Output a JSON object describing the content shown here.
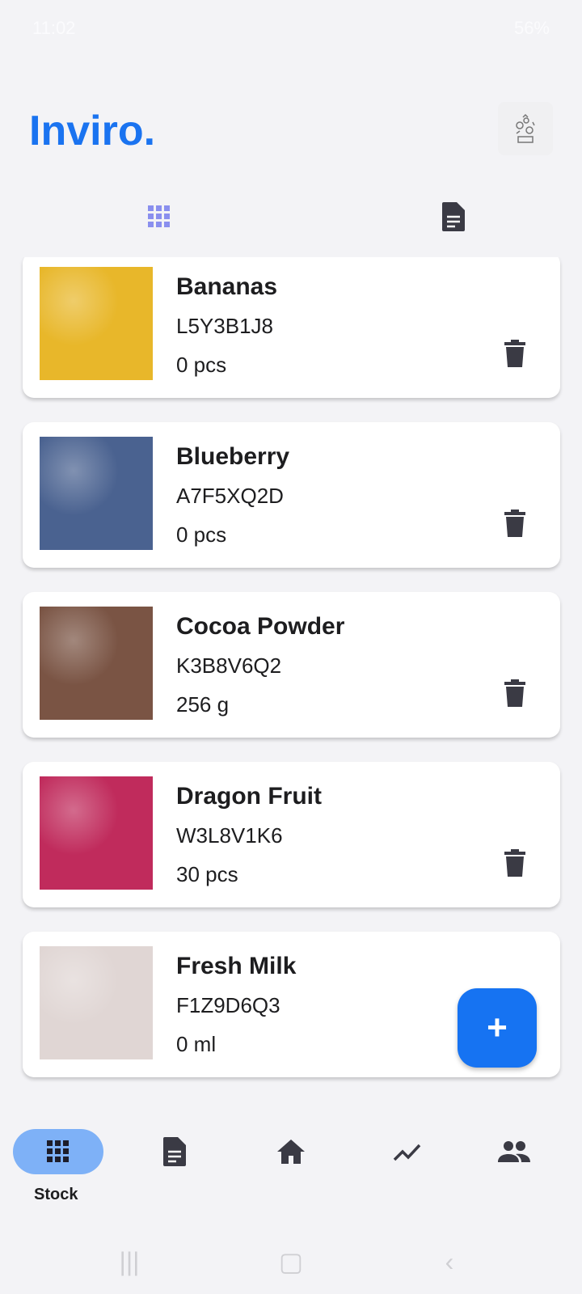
{
  "status": {
    "time": "11:02",
    "battery": "56%"
  },
  "header": {
    "title": "Inviro."
  },
  "items": [
    {
      "name": "Bananas",
      "code": "L5Y3B1J8",
      "qty": "0 pcs",
      "color": "#e8b72a"
    },
    {
      "name": "Blueberry",
      "code": "A7F5XQ2D",
      "qty": "0 pcs",
      "color": "#4a6290"
    },
    {
      "name": "Cocoa Powder",
      "code": "K3B8V6Q2",
      "qty": "256 g",
      "color": "#7a5444"
    },
    {
      "name": "Dragon Fruit",
      "code": "W3L8V1K6",
      "qty": "30 pcs",
      "color": "#c02b5c"
    },
    {
      "name": "Fresh Milk",
      "code": "F1Z9D6Q3",
      "qty": "0 ml",
      "color": "#e0d6d4"
    }
  ],
  "fab": {
    "label": "+"
  },
  "nav": {
    "active_label": "Stock"
  },
  "colors": {
    "accent": "#1a73f0",
    "nav_active": "#7eb1f7"
  }
}
